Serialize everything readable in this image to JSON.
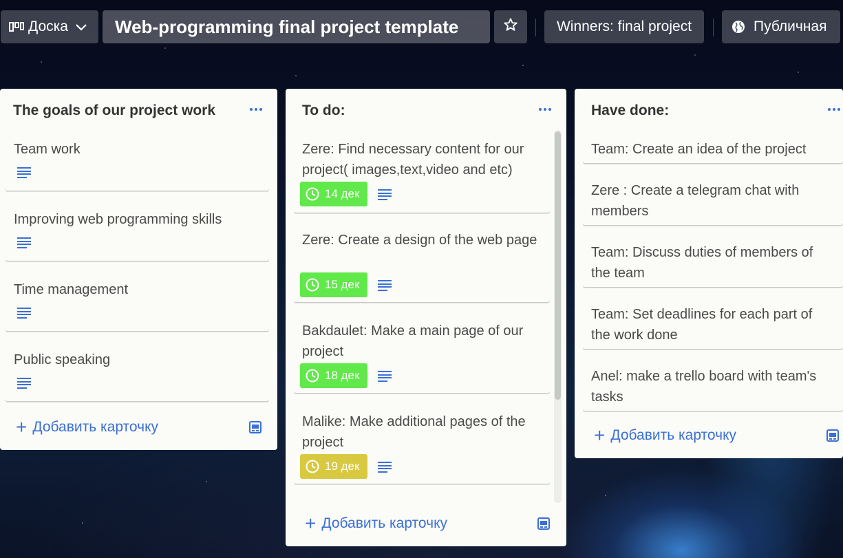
{
  "header": {
    "board_switch_label": "Доска",
    "board_title": "Web-programming final project template",
    "team_label": "Winners: final project",
    "visibility_label": "Публичная"
  },
  "lists": [
    {
      "title": "The goals of our project work",
      "cards": [
        {
          "text": "Team work"
        },
        {
          "text": "Improving web programming skills"
        },
        {
          "text": "Time management"
        },
        {
          "text": "Public speaking"
        }
      ],
      "add_card_label": "Добавить карточку"
    },
    {
      "title": "To do:",
      "cards": [
        {
          "text": "Zere: Find necessary content for our project( images,text,video and etc)",
          "due": "14 дек",
          "due_color": "#61e84a"
        },
        {
          "text": "Zere: Create a design of the web page",
          "due": "15 дек",
          "due_color": "#61e84a"
        },
        {
          "text": "Bakdaulet: Make a main page of our project",
          "due": "18 дек",
          "due_color": "#61e84a"
        },
        {
          "text": "Malike: Make additional pages of the project",
          "due": "19 дек",
          "due_color": "#d9c940"
        }
      ],
      "add_card_label": "Добавить карточку"
    },
    {
      "title": "Have done:",
      "cards": [
        {
          "text": "Team: Create an idea of the project"
        },
        {
          "text": "Zere : Create a telegram chat with members"
        },
        {
          "text": "Team: Discuss duties of members of the team"
        },
        {
          "text": "Team: Set deadlines for each part of the work done"
        },
        {
          "text": "Anel: make a trello board with team's tasks"
        }
      ],
      "add_card_label": "Добавить карточку"
    }
  ],
  "colors": {
    "accent_blue": "#3b6fd6",
    "due_green": "#61e84a",
    "due_yellow": "#d9c940"
  }
}
